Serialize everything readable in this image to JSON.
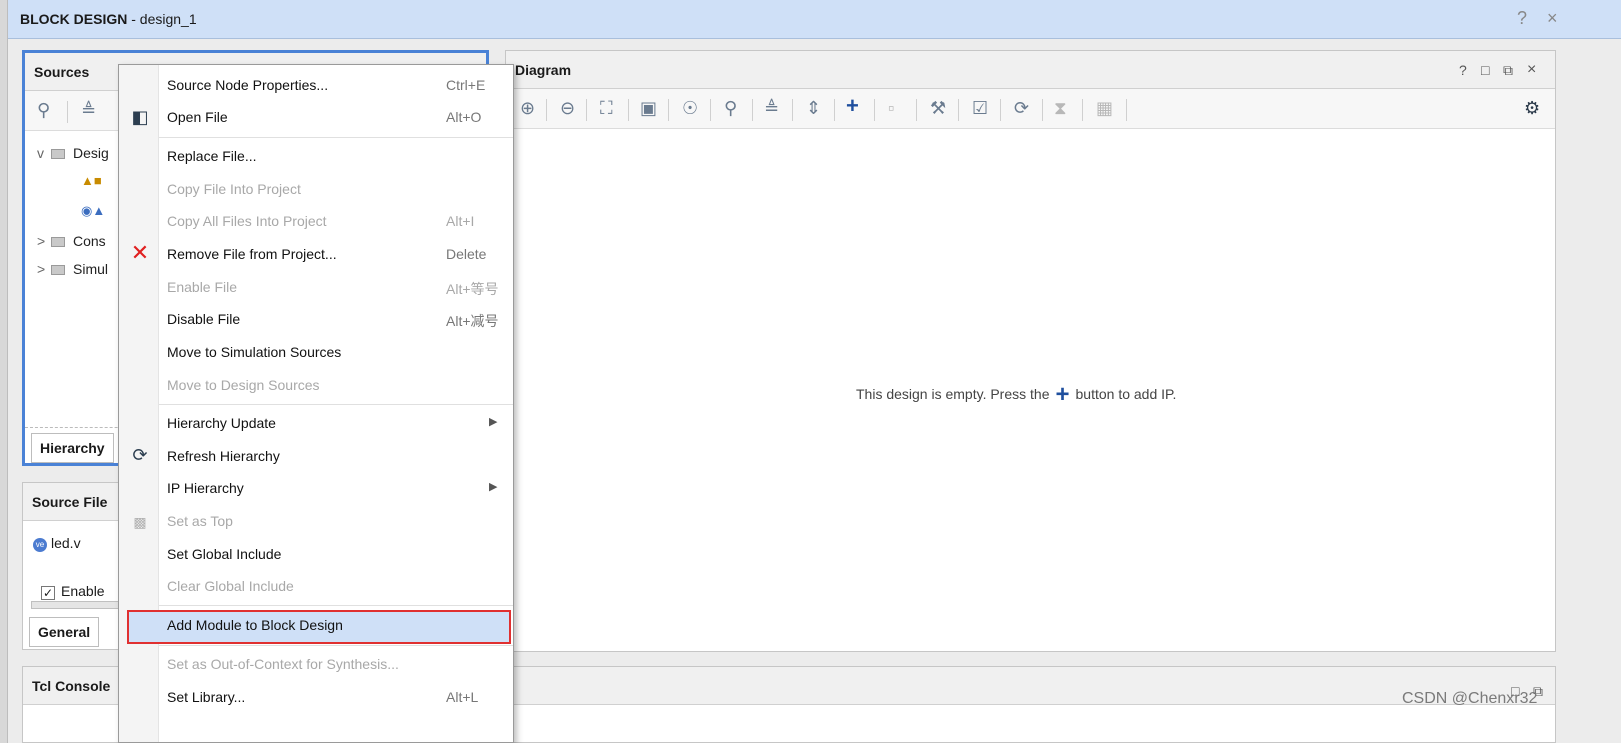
{
  "window": {
    "title_bold": "BLOCK DESIGN",
    "title_rest": " - design_1",
    "help_label": "?",
    "close_label": "×"
  },
  "sources_panel": {
    "title": "Sources",
    "tree": [
      {
        "arrow": "v",
        "label": "Desig"
      },
      {
        "arrow": ">",
        "label": "Cons"
      },
      {
        "arrow": ">",
        "label": "Simul"
      }
    ],
    "bottom_tab": "Hierarchy"
  },
  "source_file_panel": {
    "title": "Source File",
    "file": "led.v",
    "file_badge": "ve",
    "checkbox_label": "Enable",
    "bottom_tab": "General"
  },
  "tcl_panel": {
    "title": "Tcl Console"
  },
  "diagram_panel": {
    "title": "Diagram",
    "header_controls": [
      "?",
      "□",
      "⧉",
      "×"
    ],
    "empty_before": "This design is empty. Press the",
    "empty_plus": "+",
    "empty_after": "button to add IP."
  },
  "context_menu": {
    "items": [
      {
        "label": "Source Node Properties...",
        "shortcut": "Ctrl+E",
        "enabled": true
      },
      {
        "label": "Open File",
        "shortcut": "Alt+O",
        "enabled": true,
        "icon": "folder-open-icon"
      },
      {
        "label": "Replace File...",
        "shortcut": "",
        "enabled": true
      },
      {
        "label": "Copy File Into Project",
        "shortcut": "",
        "enabled": false
      },
      {
        "label": "Copy All Files Into Project",
        "shortcut": "Alt+I",
        "enabled": false
      },
      {
        "label": "Remove File from Project...",
        "shortcut": "Delete",
        "enabled": true,
        "icon": "remove-icon"
      },
      {
        "label": "Enable File",
        "shortcut": "Alt+等号",
        "enabled": false
      },
      {
        "label": "Disable File",
        "shortcut": "Alt+减号",
        "enabled": true
      },
      {
        "label": "Move to Simulation Sources",
        "shortcut": "",
        "enabled": true
      },
      {
        "label": "Move to Design Sources",
        "shortcut": "",
        "enabled": false
      },
      {
        "label": "Hierarchy Update",
        "shortcut": "",
        "enabled": true,
        "submenu": true
      },
      {
        "label": "Refresh Hierarchy",
        "shortcut": "",
        "enabled": true,
        "icon": "refresh-icon"
      },
      {
        "label": "IP Hierarchy",
        "shortcut": "",
        "enabled": true,
        "submenu": true
      },
      {
        "label": "Set as Top",
        "shortcut": "",
        "enabled": false,
        "icon": "hierarchy-icon"
      },
      {
        "label": "Set Global Include",
        "shortcut": "",
        "enabled": true
      },
      {
        "label": "Clear Global Include",
        "shortcut": "",
        "enabled": false
      },
      {
        "label": "Add Module to Block Design",
        "shortcut": "",
        "enabled": true,
        "highlighted": true
      },
      {
        "label": "Set as Out-of-Context for Synthesis...",
        "shortcut": "",
        "enabled": false
      },
      {
        "label": "Set Library...",
        "shortcut": "Alt+L",
        "enabled": true
      }
    ]
  },
  "colors": {
    "titlebar": "#cfe0f7",
    "focus_border": "#4a82d6",
    "highlight_border": "#e03030",
    "plus_blue": "#1f4f9e"
  },
  "watermark": "CSDN @Chenxr32"
}
